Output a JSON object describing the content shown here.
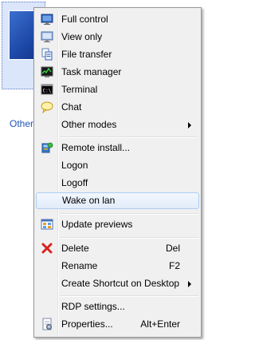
{
  "background": {
    "item_label": "Other"
  },
  "menu": {
    "items": [
      {
        "label": "Full control",
        "icon": "full-control-icon"
      },
      {
        "label": "View only",
        "icon": "view-only-icon"
      },
      {
        "label": "File transfer",
        "icon": "file-transfer-icon"
      },
      {
        "label": "Task manager",
        "icon": "task-manager-icon"
      },
      {
        "label": "Terminal",
        "icon": "terminal-icon"
      },
      {
        "label": "Chat",
        "icon": "chat-icon"
      },
      {
        "label": "Other modes",
        "icon": "",
        "submenu": true
      },
      {
        "label": "Remote install...",
        "icon": "remote-install-icon"
      },
      {
        "label": "Logon",
        "icon": ""
      },
      {
        "label": "Logoff",
        "icon": ""
      },
      {
        "label": "Wake on lan",
        "icon": "",
        "highlighted": true
      },
      {
        "label": "Update previews",
        "icon": "update-previews-icon"
      },
      {
        "label": "Delete",
        "icon": "delete-icon",
        "shortcut": "Del"
      },
      {
        "label": "Rename",
        "icon": "",
        "shortcut": "F2"
      },
      {
        "label": "Create Shortcut on Desktop",
        "icon": "",
        "submenu": true
      },
      {
        "label": "RDP settings...",
        "icon": ""
      },
      {
        "label": "Properties...",
        "icon": "properties-icon",
        "shortcut": "Alt+Enter"
      }
    ]
  },
  "colors": {
    "highlight_border": "#aeccf1",
    "menu_background": "#f0f0f0",
    "link_blue": "#1f55b4"
  }
}
